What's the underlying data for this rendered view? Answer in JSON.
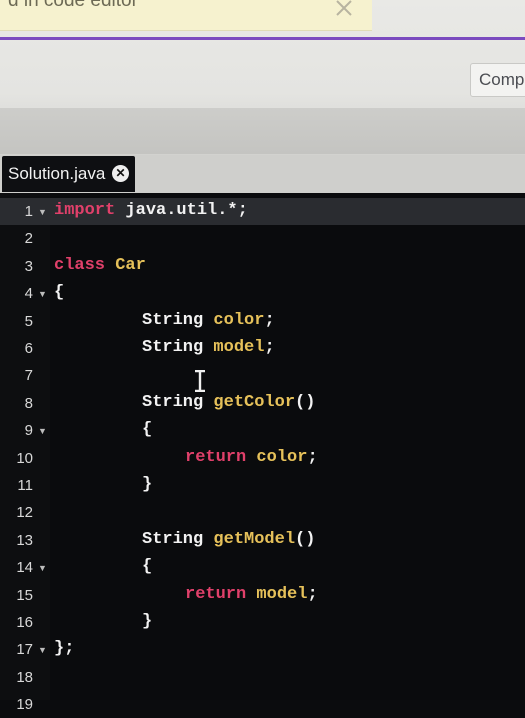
{
  "banner": {
    "text": "d in code editor"
  },
  "header": {
    "compile_label": "Compi"
  },
  "tab": {
    "label": "Solution.java"
  },
  "editor": {
    "lines": [
      {
        "n": "1",
        "fold": true,
        "active": true,
        "indent": 0,
        "tokens": [
          [
            "kw",
            "import"
          ],
          [
            "ty",
            " java.util.*;"
          ]
        ]
      },
      {
        "n": "2",
        "fold": false,
        "indent": 0,
        "tokens": []
      },
      {
        "n": "3",
        "fold": false,
        "indent": 0,
        "tokens": [
          [
            "kw",
            "class"
          ],
          [
            "id",
            " Car"
          ]
        ]
      },
      {
        "n": "4",
        "fold": true,
        "indent": 0,
        "tokens": [
          [
            "pu",
            "{"
          ]
        ]
      },
      {
        "n": "5",
        "fold": false,
        "indent": 2,
        "tokens": [
          [
            "ty",
            "String"
          ],
          [
            "id",
            " color"
          ],
          [
            "pu",
            ";"
          ]
        ]
      },
      {
        "n": "6",
        "fold": false,
        "indent": 2,
        "tokens": [
          [
            "ty",
            "String"
          ],
          [
            "id",
            " model"
          ],
          [
            "pu",
            ";"
          ]
        ]
      },
      {
        "n": "7",
        "fold": false,
        "indent": 0,
        "tokens": []
      },
      {
        "n": "8",
        "fold": false,
        "indent": 2,
        "tokens": [
          [
            "ty",
            "String"
          ],
          [
            "id",
            " getColor"
          ],
          [
            "pu",
            "()"
          ]
        ]
      },
      {
        "n": "9",
        "fold": true,
        "indent": 2,
        "tokens": [
          [
            "pu",
            "{"
          ]
        ]
      },
      {
        "n": "10",
        "fold": false,
        "indent": 3,
        "tokens": [
          [
            "kw",
            "return"
          ],
          [
            "id",
            " color"
          ],
          [
            "pu",
            ";"
          ]
        ]
      },
      {
        "n": "11",
        "fold": false,
        "indent": 2,
        "tokens": [
          [
            "pu",
            "}"
          ]
        ]
      },
      {
        "n": "12",
        "fold": false,
        "indent": 0,
        "tokens": []
      },
      {
        "n": "13",
        "fold": false,
        "indent": 2,
        "tokens": [
          [
            "ty",
            "String"
          ],
          [
            "id",
            " getModel"
          ],
          [
            "pu",
            "()"
          ]
        ]
      },
      {
        "n": "14",
        "fold": true,
        "indent": 2,
        "tokens": [
          [
            "pu",
            "{"
          ]
        ]
      },
      {
        "n": "15",
        "fold": false,
        "indent": 3,
        "tokens": [
          [
            "kw",
            "return"
          ],
          [
            "id",
            " model"
          ],
          [
            "pu",
            ";"
          ]
        ]
      },
      {
        "n": "16",
        "fold": false,
        "indent": 2,
        "tokens": [
          [
            "pu",
            "}"
          ]
        ]
      },
      {
        "n": "17",
        "fold": true,
        "indent": 0,
        "tokens": [
          [
            "pu",
            "};"
          ]
        ]
      },
      {
        "n": "18",
        "fold": false,
        "indent": 0,
        "tokens": []
      },
      {
        "n": "19",
        "fold": false,
        "indent": 0,
        "tokens": []
      }
    ]
  },
  "colors": {
    "keyword": "#e0406a",
    "identifier": "#e6c15a",
    "type": "#f2f2f2",
    "accent": "#7b4bbf"
  }
}
